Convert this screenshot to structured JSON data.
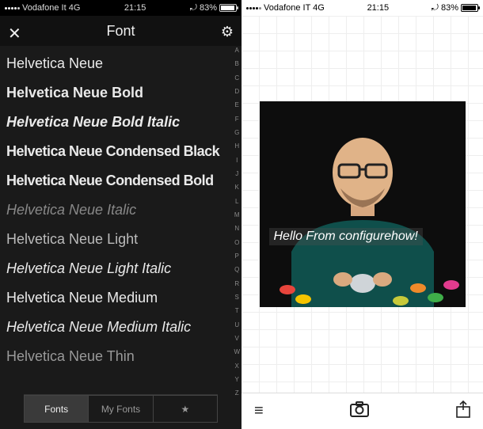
{
  "left": {
    "status": {
      "carrier": "Vodafone It 4G",
      "time": "21:15",
      "battery_pct": "83%",
      "battery_fill": 83
    },
    "header": {
      "title": "Font"
    },
    "fonts": [
      {
        "label": "Helvetica Neue",
        "css": "font-weight:400"
      },
      {
        "label": "Helvetica Neue Bold",
        "css": "font-weight:700"
      },
      {
        "label": "Helvetica Neue Bold Italic",
        "css": "font-weight:700; font-style:italic"
      },
      {
        "label": "Helvetica Neue Condensed Black",
        "css": "font-weight:800; font-stretch:condensed; letter-spacing:-0.5px"
      },
      {
        "label": "Helvetica Neue Condensed Bold",
        "css": "font-weight:700; font-stretch:condensed; letter-spacing:-0.5px"
      },
      {
        "label": "Helvetica Neue Italic",
        "css": "font-weight:400; font-style:italic; color:#888"
      },
      {
        "label": "Helvetica Neue Light",
        "css": "font-weight:300; color:#bbb"
      },
      {
        "label": "Helvetica Neue Light Italic",
        "css": "font-weight:300; font-style:italic"
      },
      {
        "label": "Helvetica Neue Medium",
        "css": "font-weight:500"
      },
      {
        "label": "Helvetica Neue Medium Italic",
        "css": "font-weight:500; font-style:italic"
      },
      {
        "label": "Helvetica Neue Thin",
        "css": "font-weight:200; color:#999"
      }
    ],
    "alpha": [
      "A",
      "B",
      "C",
      "D",
      "E",
      "F",
      "G",
      "H",
      "I",
      "J",
      "K",
      "L",
      "M",
      "N",
      "O",
      "P",
      "Q",
      "R",
      "S",
      "T",
      "U",
      "V",
      "W",
      "X",
      "Y",
      "Z"
    ],
    "tabs": {
      "fonts": "Fonts",
      "my_fonts": "My Fonts",
      "star": "★"
    }
  },
  "right": {
    "status": {
      "carrier": "Vodafone IT  4G",
      "time": "21:15",
      "battery_pct": "83%",
      "battery_fill": 83
    },
    "overlay_text": "Hello From   configurehow!",
    "icons": {
      "menu": "≡",
      "camera": "camera-icon",
      "share": "share-icon"
    }
  }
}
